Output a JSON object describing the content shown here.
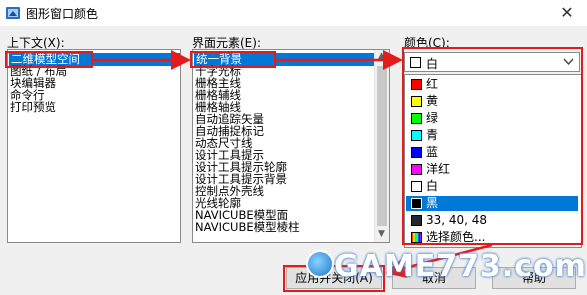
{
  "window": {
    "title": "图形窗口颜色",
    "close_glyph": "✕"
  },
  "context": {
    "label": "上下文(X):",
    "items": [
      "二维模型空间",
      "图纸 / 布局",
      "块编辑器",
      "命令行",
      "打印预览"
    ],
    "selected_index": 0
  },
  "interface": {
    "label": "界面元素(E):",
    "items": [
      "统一背景",
      "十字光标",
      "栅格主线",
      "栅格辅线",
      "栅格轴线",
      "自动追踪矢量",
      "自动捕捉标记",
      "动态尺寸线",
      "设计工具提示",
      "设计工具提示轮廓",
      "设计工具提示背景",
      "控制点外壳线",
      "光线轮廓",
      "NAVICUBE模型面",
      "NAVICUBE模型棱柱"
    ],
    "selected_index": 0
  },
  "color": {
    "label": "颜色(C):",
    "current": "白",
    "current_swatch": "#ffffff",
    "options": [
      {
        "name": "红",
        "swatch": "#ff0000"
      },
      {
        "name": "黄",
        "swatch": "#ffff00"
      },
      {
        "name": "绿",
        "swatch": "#00ff00"
      },
      {
        "name": "青",
        "swatch": "#00ffff"
      },
      {
        "name": "蓝",
        "swatch": "#0000ff"
      },
      {
        "name": "洋红",
        "swatch": "#ff00ff"
      },
      {
        "name": "白",
        "swatch": "#ffffff"
      },
      {
        "name": "黑",
        "swatch": "#000000"
      },
      {
        "name": "33, 40, 48",
        "swatch": "#212830"
      },
      {
        "name": "选择颜色...",
        "swatch": "gradient"
      }
    ],
    "highlighted_index": 7
  },
  "buttons": {
    "apply_close": "应用并关闭(A)",
    "cancel": "取消",
    "help": "帮助"
  },
  "watermark": {
    "text": "GAME773.com"
  },
  "colors": {
    "selection": "#0078d7",
    "annotation": "#e31b1b"
  }
}
